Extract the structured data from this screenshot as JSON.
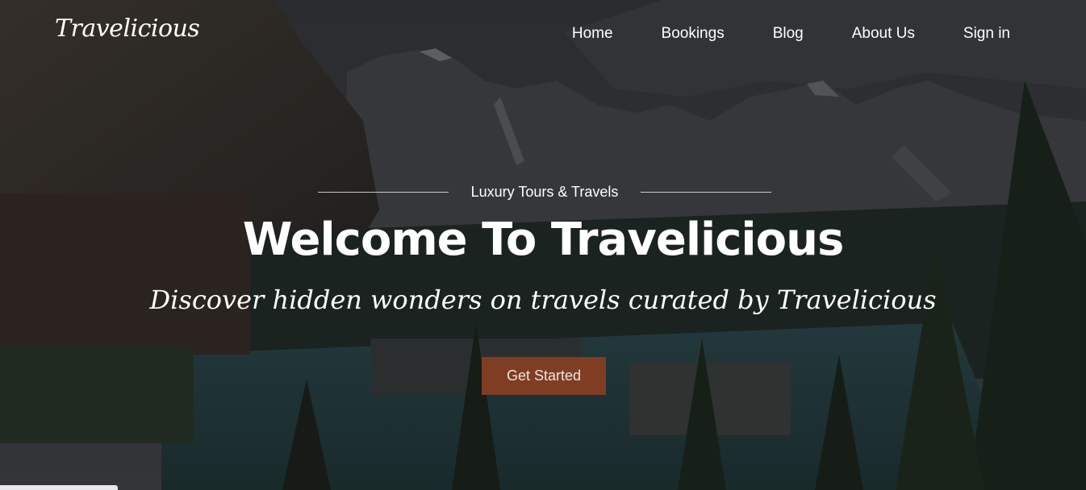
{
  "brand": {
    "logo_text": "Travelicious"
  },
  "nav": {
    "items": [
      {
        "label": "Home"
      },
      {
        "label": "Bookings"
      },
      {
        "label": "Blog"
      },
      {
        "label": "About Us"
      },
      {
        "label": "Sign in"
      }
    ]
  },
  "hero": {
    "subtitle": "Luxury Tours & Travels",
    "headline": "Welcome To Travelicious",
    "tagline": "Discover hidden wonders on travels curated by Travelicious",
    "cta_label": "Get Started",
    "background": "mountain-lake-photo"
  },
  "colors": {
    "accent": "#7f3e23",
    "text": "#ffffff"
  }
}
